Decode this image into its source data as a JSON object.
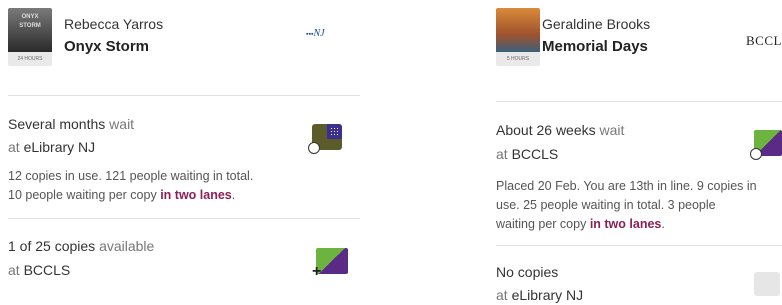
{
  "left": {
    "book": {
      "author": "Rebecca Yarros",
      "title": "Onyx Storm",
      "cover_text_1": "ONYX",
      "cover_text_2": "STORM",
      "cover_tag": "24 HOURS",
      "library_logo": "NJ"
    },
    "availability": [
      {
        "status_main": "Several months",
        "status_suffix": "wait",
        "at_label": "at",
        "library": "eLibrary NJ",
        "desc_line1": "12 copies in use. 121 people waiting in total.",
        "desc_line2_pre": "10 people waiting per copy",
        "desc_link": "in two lanes",
        "desc_end": ".",
        "icon": "calendar-clock-icon"
      },
      {
        "status_main": "1 of 25 copies",
        "status_suffix": "available",
        "at_label": "at",
        "library": "BCCLS",
        "icon": "add-book-icon"
      }
    ]
  },
  "right": {
    "book": {
      "author": "Geraldine Brooks",
      "title": "Memorial Days",
      "cover_tag": "5 HOURS",
      "library_logo": "BCCLS"
    },
    "availability": [
      {
        "status_main": "About 26 weeks",
        "status_suffix": "wait",
        "at_label": "at",
        "library": "BCCLS",
        "desc_line1": "Placed 20 Feb. You are 13th in line. 9 copies in",
        "desc_line2": "use. 25 people waiting in total. 3 people",
        "desc_line3_pre": "waiting per copy",
        "desc_link": "in two lanes",
        "desc_end": ".",
        "icon": "hold-clock-icon"
      },
      {
        "status_main": "No copies",
        "at_label": "at",
        "library": "eLibrary NJ",
        "icon": "unavailable-icon"
      }
    ]
  },
  "colors": {
    "accent": "#8b1f56",
    "green": "#6cb33f",
    "purple": "#5b2a86"
  }
}
